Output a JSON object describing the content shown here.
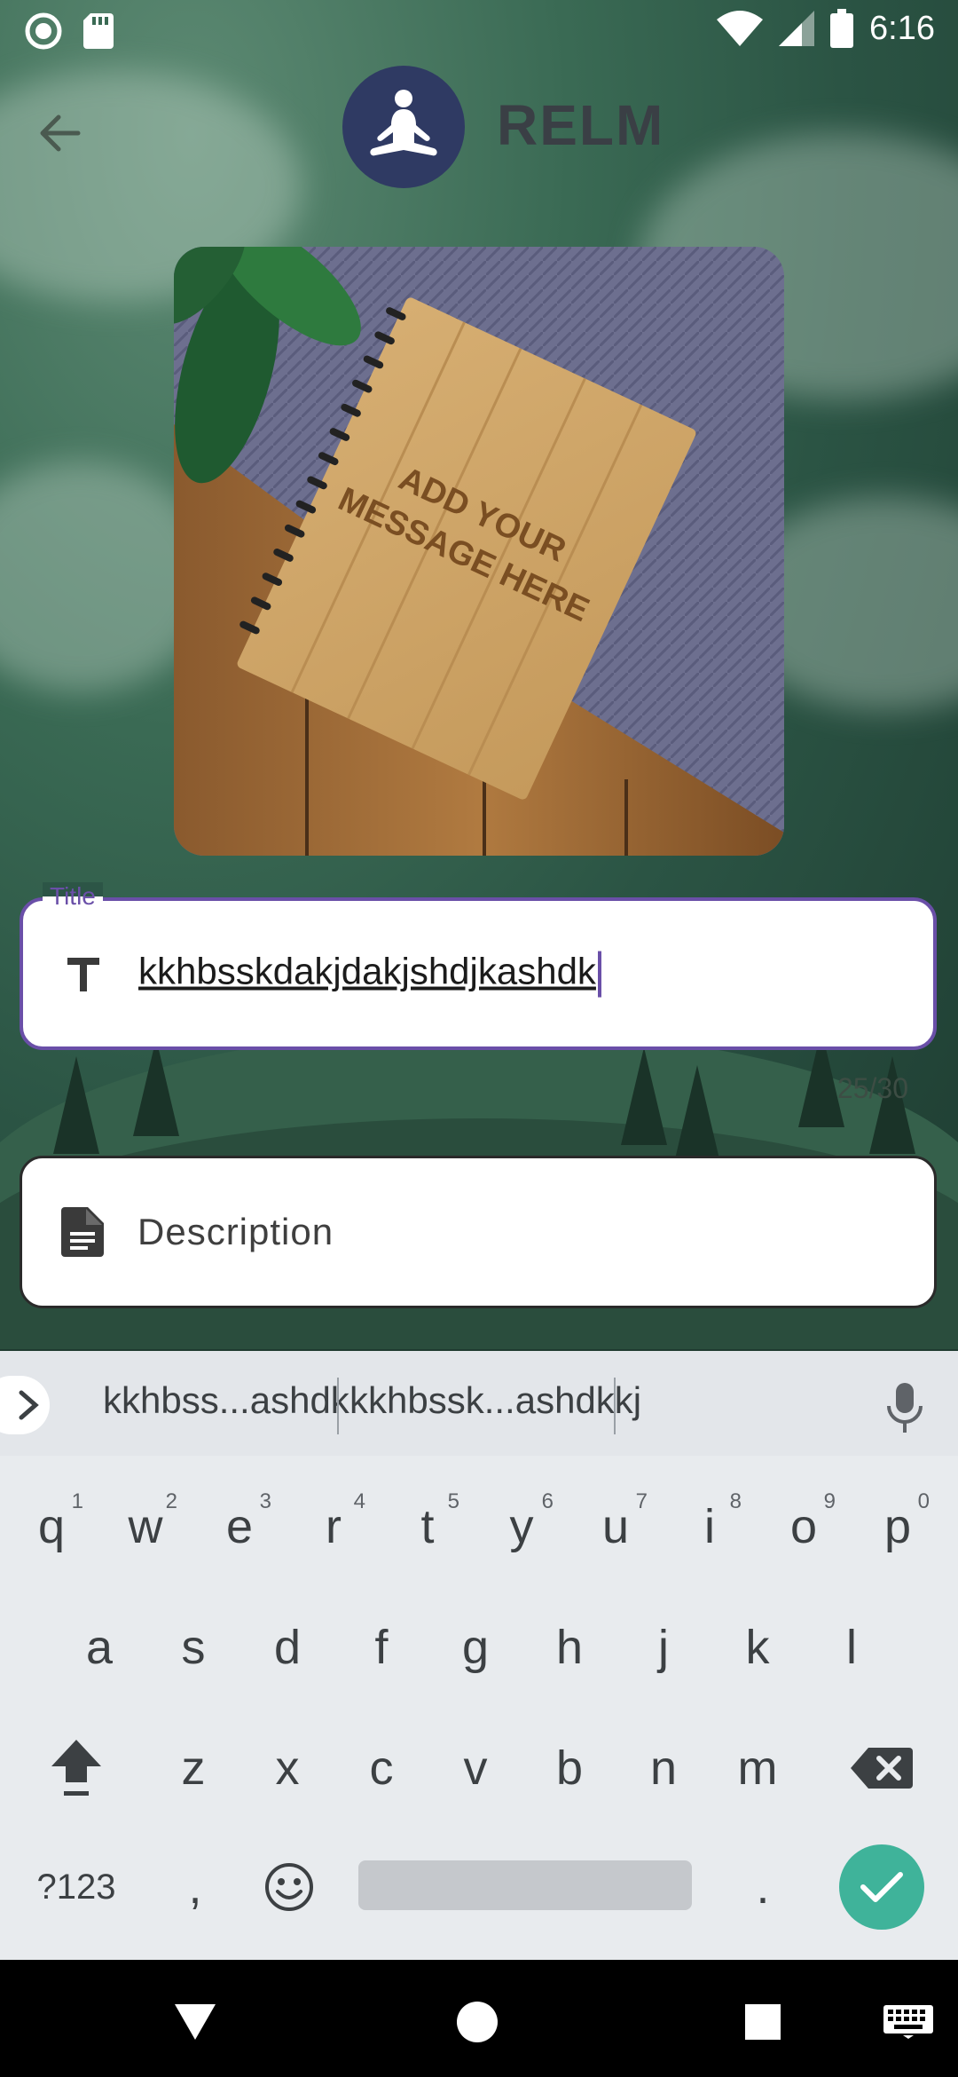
{
  "status_bar": {
    "time": "6:16"
  },
  "header": {
    "app_title": "RELM"
  },
  "image": {
    "text_line1": "ADD YOUR",
    "text_line2": "MESSAGE HERE"
  },
  "form": {
    "title_label": "Title",
    "title_value": "kkhbsskdakjdakjshdjkashdk",
    "counter": "25/30",
    "description_placeholder": "Description"
  },
  "keyboard": {
    "suggestions": [
      "kkhbss...ashdk",
      "kkhbssk...ashdkkj"
    ],
    "row1": [
      {
        "key": "q",
        "hint": "1"
      },
      {
        "key": "w",
        "hint": "2"
      },
      {
        "key": "e",
        "hint": "3"
      },
      {
        "key": "r",
        "hint": "4"
      },
      {
        "key": "t",
        "hint": "5"
      },
      {
        "key": "y",
        "hint": "6"
      },
      {
        "key": "u",
        "hint": "7"
      },
      {
        "key": "i",
        "hint": "8"
      },
      {
        "key": "o",
        "hint": "9"
      },
      {
        "key": "p",
        "hint": "0"
      }
    ],
    "row2": [
      "a",
      "s",
      "d",
      "f",
      "g",
      "h",
      "j",
      "k",
      "l"
    ],
    "row3": [
      "z",
      "x",
      "c",
      "v",
      "b",
      "n",
      "m"
    ],
    "symbols_label": "?123",
    "comma": ",",
    "period": "."
  },
  "colors": {
    "accent": "#6a4fa8",
    "enter": "#3fb39a",
    "logo_bg": "#2f3a63"
  }
}
